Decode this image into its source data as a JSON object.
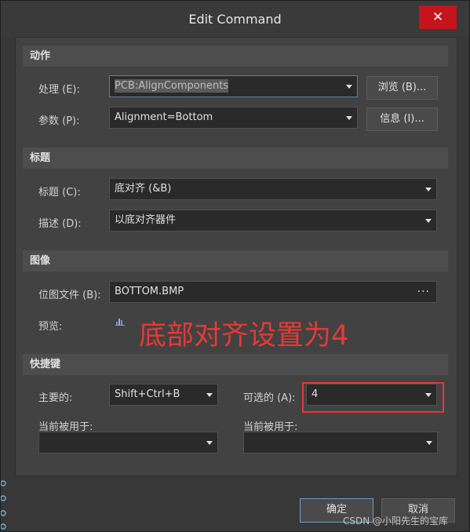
{
  "window": {
    "title": "Edit Command",
    "close_glyph": "✕"
  },
  "sections": {
    "action": {
      "header": "动作",
      "process_label": "处理 (E):",
      "process_value": "PCB:AlignComponents",
      "browse_button": "浏览 (B)...",
      "params_label": "参数 (P):",
      "params_value": "Alignment=Bottom",
      "info_button": "信息 (I)..."
    },
    "caption": {
      "header": "标题",
      "caption_label": "标题 (C):",
      "caption_value": "底对齐 (&B)",
      "desc_label": "描述 (D):",
      "desc_value": "以底对齐器件"
    },
    "image": {
      "header": "图像",
      "bitmap_label": "位图文件 (B):",
      "bitmap_value": "BOTTOM.BMP",
      "bitmap_more": "···",
      "preview_label": "预览:"
    },
    "shortcut": {
      "header": "快捷键",
      "primary_label": "主要的:",
      "primary_value": "Shift+Ctrl+B",
      "alt_label": "可选的 (A):",
      "alt_value": "4",
      "primary_used_label": "当前被用于:",
      "primary_used_value": "",
      "alt_used_label": "当前被用于:",
      "alt_used_value": ""
    }
  },
  "annotation": {
    "text": "底部对齐设置为4",
    "color": "#e53935"
  },
  "buttons": {
    "ok": "确定",
    "cancel": "取消"
  },
  "watermark": "CSDN @小阳先生的宝库",
  "icons": {
    "close": "close-icon",
    "caret": "chevron-down-icon",
    "preview": "bitmap-preview-icon"
  }
}
